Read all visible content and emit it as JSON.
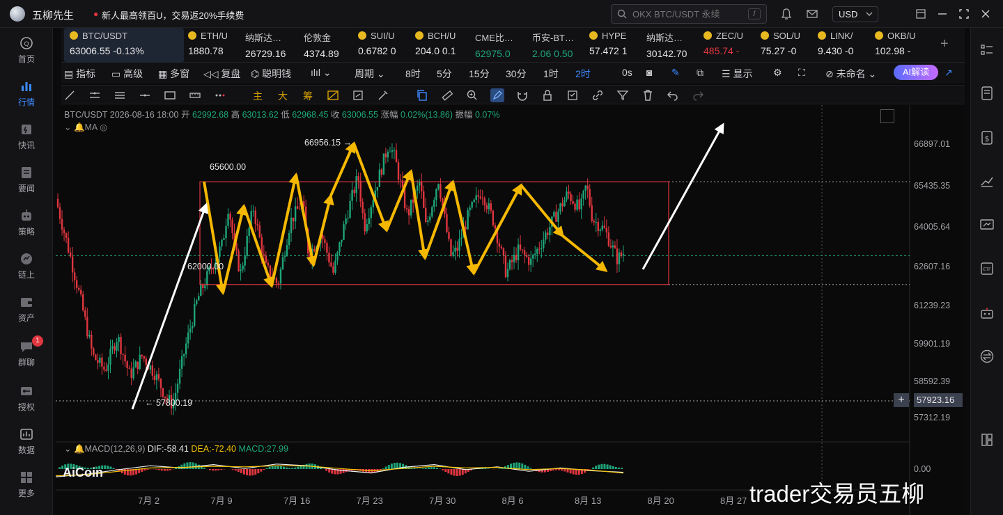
{
  "titlebar": {
    "app_title": "五柳先生",
    "promo": "新人最高领百U，交易返20%手续费",
    "search_placeholder": "OKX BTC/USDT 永续",
    "search_shortcut": "/",
    "currency": "USD"
  },
  "left_nav": [
    {
      "label": "首页",
      "icon": "home-icon"
    },
    {
      "label": "行情",
      "icon": "market-icon",
      "active": true
    },
    {
      "label": "快讯",
      "icon": "flash-news-icon"
    },
    {
      "label": "要闻",
      "icon": "news-icon"
    },
    {
      "label": "策略",
      "icon": "strategy-icon"
    },
    {
      "label": "链上",
      "icon": "onchain-icon"
    },
    {
      "label": "资产",
      "icon": "wallet-icon"
    },
    {
      "label": "群聊",
      "icon": "chat-icon",
      "badge": "1"
    },
    {
      "label": "授权",
      "icon": "key-icon"
    },
    {
      "label": "数据",
      "icon": "data-icon"
    },
    {
      "label": "更多",
      "icon": "more-grid-icon"
    }
  ],
  "tickers": [
    {
      "name": "BTC/USDT",
      "price": "63006.55",
      "change": "-0.13%",
      "coin": true
    },
    {
      "name": "ETH/U",
      "price": "1880.78",
      "coin": true
    },
    {
      "name": "纳斯达…",
      "price": "26729.16"
    },
    {
      "name": "伦敦金",
      "price": "4374.89"
    },
    {
      "name": "SUI/U",
      "price": "0.6782 0",
      "coin": true
    },
    {
      "name": "BCH/U",
      "price": "204.0 0.1",
      "coin": true
    },
    {
      "name": "CME比…",
      "price": "62975.0",
      "green": true
    },
    {
      "name": "币安-BT…",
      "price": "2.06 0.50",
      "green": true
    },
    {
      "name": "HYPE",
      "price": "57.472 1",
      "coin": true
    },
    {
      "name": "纳斯达…",
      "price": "30142.70"
    },
    {
      "name": "ZEC/U",
      "price": "485.74 -",
      "coin": true,
      "red": true
    },
    {
      "name": "SOL/U",
      "price": "75.27 -0",
      "coin": true
    },
    {
      "name": "LINK/",
      "price": "9.430 -0",
      "coin": true
    },
    {
      "name": "OKB/U",
      "price": "102.98 -",
      "coin": true
    }
  ],
  "toolbar": {
    "indicators": "指标",
    "advanced": "高级",
    "multi": "多窗",
    "replay": "复盘",
    "smart_money": "聪明钱",
    "period": "周期",
    "intervals": [
      "8时",
      "5分",
      "15分",
      "30分",
      "1时",
      "2时"
    ],
    "active_interval": "2时",
    "countdown": "0s",
    "display": "显示",
    "layout_name": "未命名",
    "ai_button": "AI解读"
  },
  "draw_labels": [
    "主",
    "大",
    "筹"
  ],
  "chart_info": {
    "symbol": "BTC/USDT",
    "datetime": "2026-08-16 18:00",
    "open_label": "开",
    "open": "62992.68",
    "high_label": "高",
    "high": "63013.62",
    "low_label": "低",
    "low": "62968.45",
    "close_label": "收",
    "close": "63006.55",
    "change_label": "涨幅",
    "change": "0.02%(13.86)",
    "amp_label": "振幅",
    "amp": "0.07%",
    "ma_label": "MA",
    "macd_label": "MACD(12,26,9)",
    "dif": "DIF:-58.41",
    "dea": "DEA:-72.40",
    "macd": "MACD:27.99",
    "macd_zero": "0.00",
    "crosshair_price": "57923.16",
    "watermark": "trader交易员五柳",
    "logo": "AiCoin"
  },
  "chart_data": {
    "type": "candlestick",
    "symbol": "BTC/USDT",
    "y_ticks": [
      66897.01,
      65435.35,
      64005.64,
      62607.16,
      61239.23,
      59901.19,
      58592.39,
      57312.19
    ],
    "x_ticks": [
      "7月 2",
      "7月 9",
      "7月 16",
      "7月 23",
      "7月 30",
      "8月 6",
      "8月 13",
      "8月 20",
      "8月 27"
    ],
    "annotations": {
      "range_top": 65600.0,
      "range_bottom": 62000.0,
      "swing_high": 66956.15,
      "swing_low": 57800.19
    },
    "price_path": [
      [
        0,
        65000
      ],
      [
        2,
        63300
      ],
      [
        4,
        61500
      ],
      [
        6,
        59500
      ],
      [
        8,
        59000
      ],
      [
        10,
        60200
      ],
      [
        12,
        58800
      ],
      [
        14,
        59500
      ],
      [
        16,
        58900
      ],
      [
        18,
        58000
      ],
      [
        19,
        57800
      ],
      [
        21,
        59800
      ],
      [
        23,
        61500
      ],
      [
        25,
        62500
      ],
      [
        27,
        63400
      ],
      [
        28,
        64800
      ],
      [
        29,
        63200
      ],
      [
        30,
        62400
      ],
      [
        32,
        64700
      ],
      [
        34,
        62600
      ],
      [
        36,
        62000
      ],
      [
        38,
        64200
      ],
      [
        40,
        64900
      ],
      [
        41,
        63000
      ],
      [
        43,
        63800
      ],
      [
        45,
        62400
      ],
      [
        47,
        64300
      ],
      [
        49,
        65800
      ],
      [
        50,
        64000
      ],
      [
        52,
        65500
      ],
      [
        54,
        66956
      ],
      [
        55,
        66400
      ],
      [
        57,
        64400
      ],
      [
        59,
        65600
      ],
      [
        60,
        64000
      ],
      [
        62,
        65700
      ],
      [
        64,
        63000
      ],
      [
        65,
        63200
      ],
      [
        67,
        64500
      ],
      [
        69,
        65300
      ],
      [
        71,
        64200
      ],
      [
        73,
        62400
      ],
      [
        75,
        63200
      ],
      [
        77,
        62800
      ],
      [
        79,
        63600
      ],
      [
        81,
        64400
      ],
      [
        83,
        65200
      ],
      [
        85,
        64600
      ],
      [
        86,
        65500
      ],
      [
        87,
        64300
      ],
      [
        89,
        63900
      ],
      [
        91,
        62900
      ],
      [
        92,
        63100
      ]
    ],
    "macd_dif": [
      -140,
      -90,
      -10,
      60,
      20,
      80,
      10,
      90,
      60,
      -20,
      -70,
      30,
      80,
      -10,
      40,
      -40,
      20,
      -30,
      -58
    ],
    "macd_dea": [
      -120,
      -100,
      -40,
      20,
      30,
      50,
      40,
      60,
      55,
      10,
      -30,
      10,
      50,
      20,
      30,
      -10,
      10,
      -20,
      -72
    ]
  },
  "colors": {
    "up": "#1ea57a",
    "down": "#e0363f",
    "arrow_yellow": "#f5b800",
    "arrow_white": "#ffffff",
    "range_box": "#e0363f",
    "accent_blue": "#3d8bff"
  }
}
